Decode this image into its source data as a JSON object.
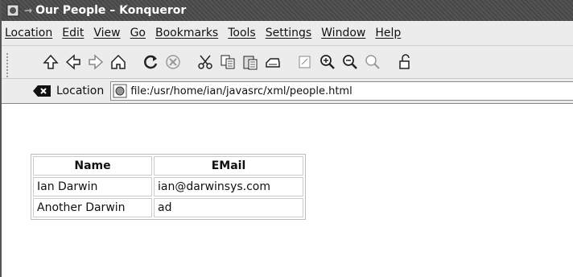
{
  "window": {
    "title": "Our People – Konqueror"
  },
  "menubar": {
    "items": [
      "Location",
      "Edit",
      "View",
      "Go",
      "Bookmarks",
      "Tools",
      "Settings",
      "Window",
      "Help"
    ]
  },
  "toolbar": {
    "icons": [
      "up-icon",
      "back-icon",
      "forward-icon",
      "home-icon",
      "reload-icon",
      "stop-icon",
      "cut-icon",
      "copy-icon",
      "paste-icon",
      "print-icon",
      "frame-icon",
      "zoom-in-icon",
      "zoom-out-icon",
      "find-icon",
      "security-icon"
    ]
  },
  "location_bar": {
    "label": "Location",
    "url": "file:/usr/home/ian/javasrc/xml/people.html"
  },
  "table": {
    "headers": [
      "Name",
      "EMail"
    ],
    "rows": [
      [
        "Ian Darwin",
        "ian@darwinsys.com"
      ],
      [
        "Another Darwin",
        "ad"
      ]
    ]
  }
}
